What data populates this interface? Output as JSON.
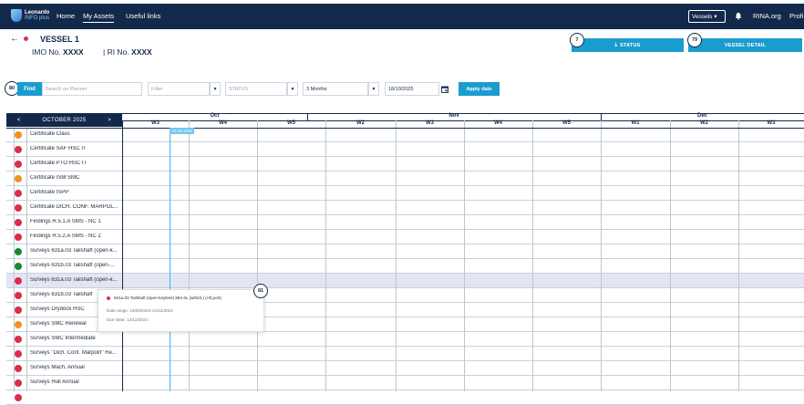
{
  "header": {
    "logo": {
      "name": "Leonardo",
      "sub": "INFO plus"
    },
    "nav": [
      "Home",
      "My Assets",
      "Useful links"
    ],
    "vessels_label": "Vessels",
    "rina_label": "RINA.org",
    "profile_label": "Profi"
  },
  "vessel": {
    "title": "VESSEL 1",
    "imo_label": "IMO No.",
    "imo_value": "XXXX",
    "ri_label": "| RI No.",
    "ri_value": "XXXX"
  },
  "actions": {
    "status_label": "STATUS",
    "status_badge": "7",
    "detail_label": "VESSEL DETAIL",
    "detail_badge": "79"
  },
  "filters": {
    "find_badge": "80",
    "find_label": "Find",
    "search_placeholder": "Search on Planner",
    "filter_placeholder": "Filter",
    "status_placeholder": "STATUS",
    "period_value": "3 Months",
    "date_value": "18/10/2025",
    "apply_label": "Apply date"
  },
  "planner": {
    "month_nav": {
      "prev": "<",
      "label": "OCTOBER 2025",
      "next": ">"
    },
    "months": [
      "Oct",
      "Nov",
      "Dec"
    ],
    "weeks": [
      "W3",
      "W4",
      "W5",
      "W2",
      "W3",
      "W4",
      "W5",
      "W1",
      "W2",
      "W3"
    ],
    "today_label": "18-10-2025",
    "rows": [
      {
        "label": "Certificate Class",
        "color": "#f0931e"
      },
      {
        "label": "Certificate SAF HSC IT",
        "color": "#d6304b"
      },
      {
        "label": "Certificate PTO HSC IT",
        "color": "#d6304b"
      },
      {
        "label": "Certificate ISM SMC",
        "color": "#f0931e"
      },
      {
        "label": "Certificate ISPP",
        "color": "#d6304b"
      },
      {
        "label": "Certificate DICH. CONF. MARPOL...",
        "color": "#d6304b"
      },
      {
        "label": "Findings R.5.1.A SMS - NC 1",
        "color": "#d6304b"
      },
      {
        "label": "Findings R.5.2.A SMS - NC 2",
        "color": "#d6304b"
      },
      {
        "label": "Surveys 631a.03 Tailshaft (open-k...",
        "color": "#1a8a2a"
      },
      {
        "label": "Surveys 631b.03 Tailshaft (open-...",
        "color": "#1a8a2a"
      },
      {
        "label": "Surveys 631a.03 Tailshaft (open-k...",
        "color": "#d6304b"
      },
      {
        "label": "Surveys 631b.03 Tailshaft",
        "color": "#d6304b"
      },
      {
        "label": "Surveys Drydock HSC",
        "color": "#d6304b"
      },
      {
        "label": "Surveys SMC Renewal",
        "color": "#f0931e"
      },
      {
        "label": "Surveys SMC Intermediate",
        "color": "#d6304b"
      },
      {
        "label": "Surveys \"Dich. Conf. Marpol/I\" Re...",
        "color": "#d6304b"
      },
      {
        "label": "Surveys Mach. Annual",
        "color": "#d6304b"
      },
      {
        "label": "Surveys Hull Annual",
        "color": "#d6304b"
      },
      {
        "label": "",
        "color": "#d6304b"
      }
    ],
    "selected_row": 10
  },
  "tooltip": {
    "badge": "81",
    "title": "631a.03 Tailshaft (open-keyless) Met.4L (withdr.) (Aft,port)",
    "date_range": "Date range: 15/09/2024-14/12/2024",
    "due_date": "Due Date: 14/12/2024"
  }
}
